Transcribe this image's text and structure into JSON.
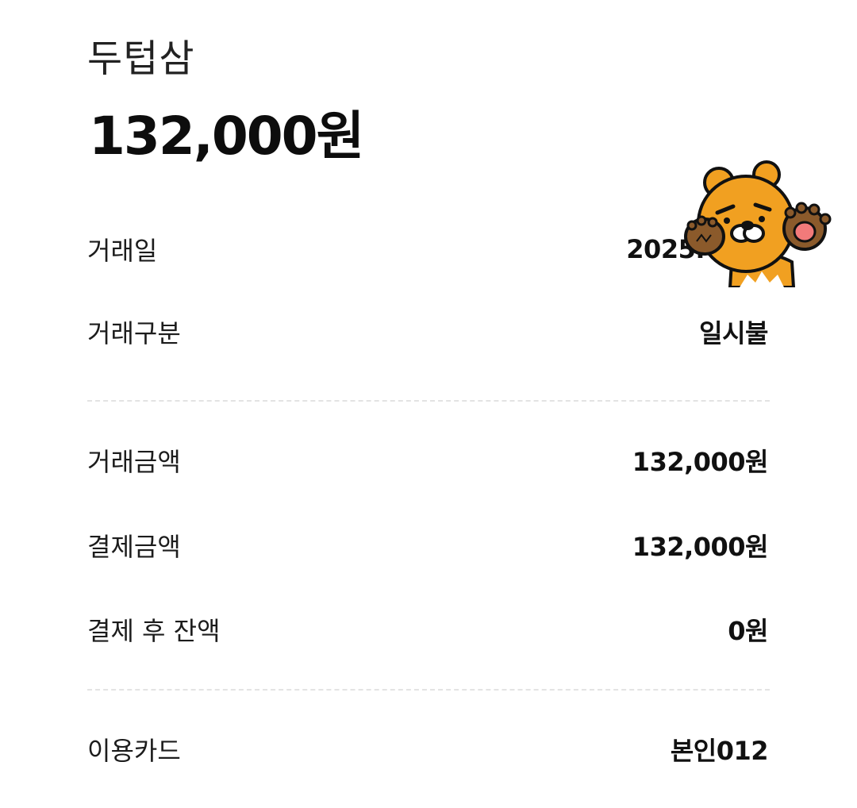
{
  "header": {
    "merchant": "두텁삼",
    "amount": "132,000원"
  },
  "details": {
    "date": {
      "label": "거래일",
      "value": "2025."
    },
    "type": {
      "label": "거래구분",
      "value": "일시불"
    },
    "txn_amount": {
      "label": "거래금액",
      "value": "132,000원"
    },
    "paid_amount": {
      "label": "결제금액",
      "value": "132,000원"
    },
    "balance": {
      "label": "결제 후 잔액",
      "value": "0원"
    },
    "card": {
      "label": "이용카드",
      "value": "본인012"
    }
  },
  "sticker": {
    "icon": "lion-character-sticker"
  },
  "colors": {
    "text": "#111111",
    "divider": "#e3e3e3",
    "sticker_face": "#F1A021",
    "sticker_paw": "#8B5A2B"
  }
}
